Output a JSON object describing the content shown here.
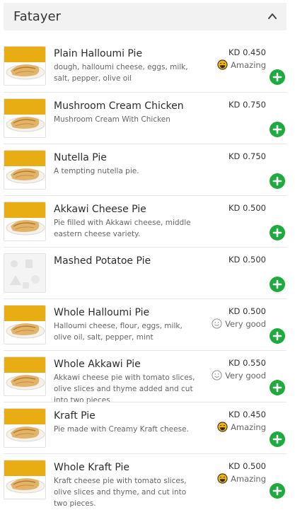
{
  "section": {
    "title": "Fatayer"
  },
  "colors": {
    "accent": "#1faa3e",
    "header_bg": "#f2f2f2",
    "rating_icon": "#f5b400"
  },
  "items": [
    {
      "name": "Plain Halloumi Pie",
      "description": "dough, halloumi cheese, eggs, milk, salt, pepper, olive oil",
      "price": "KD 0.450",
      "rating": "Amazing",
      "rating_icon": "amazing-face-icon",
      "image": "pie-photo"
    },
    {
      "name": "Mushroom Cream Chicken",
      "description": "Mushroom Cream With Chicken",
      "price": "KD 0.750",
      "rating": "",
      "rating_icon": "",
      "image": "pie-photo"
    },
    {
      "name": "Nutella Pie",
      "description": "A tempting nutella pie.",
      "price": "KD 0.750",
      "rating": "",
      "rating_icon": "",
      "image": "pie-photo"
    },
    {
      "name": "Akkawi Cheese Pie",
      "description": "Pie filled with Akkawi cheese, middle eastern cheese variety.",
      "price": "KD 0.500",
      "rating": "",
      "rating_icon": "",
      "image": "pie-photo"
    },
    {
      "name": "Mashed Potatoe Pie",
      "description": "",
      "price": "KD 0.500",
      "rating": "",
      "rating_icon": "",
      "image": "placeholder"
    },
    {
      "name": "Whole Halloumi Pie",
      "description": "Halloumi cheese, flour, eggs, milk, olive oil, salt, pepper, mint",
      "price": "KD 0.500",
      "rating": "Very good",
      "rating_icon": "very-good-face-icon",
      "image": "pie-photo"
    },
    {
      "name": "Whole Akkawi Pie",
      "description": "Akkawi cheese pie with tomato slices, olive slices and thyme added and cut into two pieces",
      "price": "KD 0.550",
      "rating": "Very good",
      "rating_icon": "very-good-face-icon",
      "image": "pie-photo"
    },
    {
      "name": "Kraft Pie",
      "description": "Pie made with Creamy Kraft cheese.",
      "price": "KD 0.450",
      "rating": "Amazing",
      "rating_icon": "amazing-face-icon",
      "image": "pie-photo"
    },
    {
      "name": "Whole Kraft Pie",
      "description": "Kraft cheese pie with tomato slices, olive slices and thyme, and cut into two pieces.",
      "price": "KD 0.500",
      "rating": "Amazing",
      "rating_icon": "amazing-face-icon",
      "image": "pie-photo"
    }
  ]
}
